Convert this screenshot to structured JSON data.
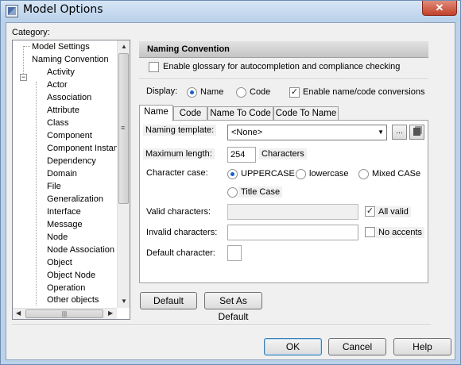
{
  "window": {
    "title": "Model Options",
    "close_glyph": "✕"
  },
  "category": {
    "label": "Category:",
    "tree": [
      {
        "label": "Model Settings"
      },
      {
        "label": "Naming Convention",
        "expanded": true
      },
      {
        "label": "Activity"
      },
      {
        "label": "Actor"
      },
      {
        "label": "Association"
      },
      {
        "label": "Attribute"
      },
      {
        "label": "Class"
      },
      {
        "label": "Component"
      },
      {
        "label": "Component Instan"
      },
      {
        "label": "Dependency"
      },
      {
        "label": "Domain"
      },
      {
        "label": "File"
      },
      {
        "label": "Generalization"
      },
      {
        "label": "Interface"
      },
      {
        "label": "Message"
      },
      {
        "label": "Node"
      },
      {
        "label": "Node Association"
      },
      {
        "label": "Object"
      },
      {
        "label": "Object Node"
      },
      {
        "label": "Operation"
      },
      {
        "label": "Other objects"
      }
    ],
    "expander_glyph": "−"
  },
  "section": {
    "title": "Naming Convention",
    "enable_glossary_label": "Enable glossary for autocompletion and compliance checking",
    "enable_glossary_checked": false
  },
  "display": {
    "label": "Display:",
    "options": [
      "Name",
      "Code"
    ],
    "selected": "Name",
    "enable_conversions_label": "Enable name/code conversions",
    "enable_conversions_checked": true
  },
  "tabs": [
    "Name",
    "Code",
    "Name To Code",
    "Code To Name"
  ],
  "active_tab": "Name",
  "name_tab": {
    "naming_template_label": "Naming template:",
    "naming_template_value": "<None>",
    "ellipsis_label": "...",
    "maximum_length_label": "Maximum length:",
    "maximum_length_value": "254",
    "characters_label": "Characters",
    "character_case_label": "Character case:",
    "case_options": [
      "UPPERCASE",
      "lowercase",
      "Mixed CASe",
      "Title Case"
    ],
    "case_selected": "UPPERCASE",
    "valid_characters_label": "Valid characters:",
    "valid_characters_value": "",
    "all_valid_label": "All valid",
    "all_valid_checked": true,
    "invalid_characters_label": "Invalid characters:",
    "invalid_characters_value": "",
    "no_accents_label": "No accents",
    "no_accents_checked": false,
    "default_character_label": "Default character:",
    "default_character_value": ""
  },
  "actions": {
    "default_label": "Default",
    "set_as_default_label": "Set As Default",
    "ok_label": "OK",
    "cancel_label": "Cancel",
    "help_label": "Help"
  }
}
